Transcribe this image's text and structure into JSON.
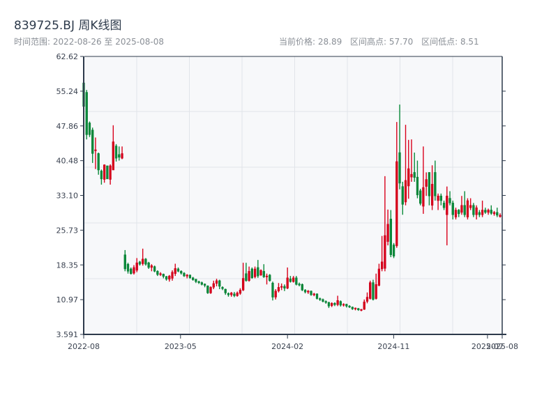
{
  "header": {
    "title": "839725.BJ 周K线图",
    "range": "时间范围: 2022-08-26 至 2025-08-08",
    "current_price": "当前价格: 28.89",
    "range_high": "区间高点: 57.70",
    "range_low": "区间低点: 8.51"
  },
  "chart_data": {
    "type": "candlestick",
    "title": "839725.BJ 周K线图",
    "x_start": "2022-08-26",
    "x_end": "2025-08-08",
    "ylim": [
      3.591,
      62.62
    ],
    "y_ticks": [
      "62.62",
      "55.24",
      "47.86",
      "40.48",
      "33.10",
      "25.73",
      "18.35",
      "10.97",
      "3.591"
    ],
    "x_ticks": [
      {
        "label": "2022-08",
        "date": "2022-08-26"
      },
      {
        "label": "2023-05",
        "date": "2023-05-01"
      },
      {
        "label": "2024-02",
        "date": "2024-02-01"
      },
      {
        "label": "2024-11",
        "date": "2024-11-01"
      },
      {
        "label": "2025-07",
        "date": "2025-07-01"
      },
      {
        "label": "2025-08",
        "date": "2025-08-08"
      }
    ],
    "grid": true,
    "colors": {
      "up": "#d9001b",
      "down": "#0a8a3a",
      "background": "#f7f8fa",
      "grid": "#e1e4e9",
      "axis": "#2d3a4b"
    },
    "candle_fields": [
      "open",
      "close",
      "low",
      "high"
    ],
    "candles": [
      [
        57.0,
        52.0,
        51.5,
        57.7
      ],
      [
        55.0,
        46.0,
        45.0,
        55.5
      ],
      [
        48.5,
        46.0,
        45.5,
        48.8
      ],
      [
        47.0,
        42.0,
        40.0,
        47.5
      ],
      [
        42.6,
        42.8,
        38.7,
        45.4
      ],
      [
        42.0,
        38.5,
        37.5,
        42.2
      ],
      [
        38.3,
        36.6,
        35.4,
        38.6
      ],
      [
        36.5,
        39.6,
        35.8,
        39.7
      ],
      [
        39.4,
        36.6,
        36.6,
        39.4
      ],
      [
        36.5,
        39.4,
        35.4,
        39.7
      ],
      [
        38.5,
        44.5,
        38.5,
        48.0
      ],
      [
        43.6,
        41.0,
        40.3,
        44.0
      ],
      [
        41.8,
        41.2,
        40.5,
        43.5
      ],
      [
        41.0,
        42.0,
        40.8,
        43.5
      ],
      [
        20.5,
        17.5,
        17.0,
        21.5
      ],
      [
        18.5,
        17.0,
        16.5,
        18.8
      ],
      [
        17.5,
        16.5,
        16.3,
        17.8
      ],
      [
        16.6,
        17.8,
        16.3,
        18.3
      ],
      [
        17.2,
        18.8,
        16.8,
        19.8
      ],
      [
        19.0,
        18.5,
        18.2,
        19.2
      ],
      [
        18.6,
        19.6,
        18.2,
        21.8
      ],
      [
        19.6,
        18.5,
        18.2,
        19.8
      ],
      [
        18.8,
        17.8,
        17.5,
        19.0
      ],
      [
        17.8,
        18.2,
        17.0,
        18.5
      ],
      [
        18.0,
        17.0,
        16.8,
        18.2
      ],
      [
        17.0,
        16.3,
        16.0,
        17.2
      ],
      [
        16.3,
        16.5,
        16.0,
        16.8
      ],
      [
        16.4,
        15.9,
        15.5,
        16.5
      ],
      [
        15.9,
        15.3,
        15.0,
        16.0
      ],
      [
        15.3,
        16.0,
        14.8,
        16.2
      ],
      [
        15.5,
        16.8,
        15.0,
        17.2
      ],
      [
        16.5,
        17.6,
        16.0,
        18.6
      ],
      [
        17.5,
        17.0,
        16.8,
        17.8
      ],
      [
        17.0,
        16.6,
        16.3,
        17.2
      ],
      [
        16.6,
        16.0,
        15.8,
        16.8
      ],
      [
        16.0,
        16.2,
        15.5,
        16.4
      ],
      [
        16.2,
        15.6,
        15.4,
        16.3
      ],
      [
        15.6,
        15.2,
        15.0,
        15.8
      ],
      [
        15.3,
        14.8,
        14.5,
        15.4
      ],
      [
        14.8,
        14.6,
        14.3,
        15.0
      ],
      [
        14.6,
        14.2,
        14.0,
        14.8
      ],
      [
        14.3,
        14.0,
        13.6,
        14.4
      ],
      [
        13.9,
        12.4,
        12.2,
        14.0
      ],
      [
        12.4,
        13.6,
        12.2,
        13.8
      ],
      [
        13.6,
        14.4,
        13.2,
        15.0
      ],
      [
        14.4,
        15.0,
        13.8,
        15.4
      ],
      [
        15.0,
        13.8,
        13.2,
        15.2
      ],
      [
        13.6,
        13.3,
        13.0,
        13.8
      ],
      [
        13.2,
        12.4,
        12.0,
        13.3
      ],
      [
        12.3,
        12.0,
        11.6,
        12.5
      ],
      [
        12.0,
        12.4,
        11.6,
        12.6
      ],
      [
        12.2,
        11.8,
        11.5,
        12.6
      ],
      [
        11.8,
        12.4,
        11.6,
        12.7
      ],
      [
        12.3,
        13.0,
        12.0,
        13.4
      ],
      [
        13.0,
        15.5,
        12.8,
        18.8
      ],
      [
        16.5,
        15.0,
        14.8,
        18.8
      ],
      [
        15.0,
        17.0,
        14.8,
        18.0
      ],
      [
        17.5,
        15.6,
        15.4,
        17.8
      ],
      [
        15.8,
        17.5,
        15.5,
        18.0
      ],
      [
        17.8,
        16.0,
        15.6,
        19.4
      ],
      [
        16.2,
        17.2,
        16.0,
        17.4
      ],
      [
        17.0,
        15.8,
        15.6,
        18.5
      ],
      [
        15.8,
        16.0,
        14.2,
        16.5
      ],
      [
        16.2,
        15.0,
        14.8,
        16.4
      ],
      [
        14.5,
        11.5,
        10.8,
        14.8
      ],
      [
        11.5,
        12.8,
        11.0,
        13.2
      ],
      [
        12.8,
        13.6,
        12.5,
        14.5
      ],
      [
        13.6,
        13.8,
        13.0,
        14.4
      ],
      [
        13.8,
        13.4,
        12.8,
        14.2
      ],
      [
        13.4,
        15.6,
        13.2,
        17.8
      ],
      [
        15.4,
        14.8,
        14.6,
        16.0
      ],
      [
        14.8,
        15.6,
        14.6,
        16.0
      ],
      [
        15.6,
        14.2,
        14.0,
        16.0
      ],
      [
        14.3,
        14.2,
        13.8,
        14.6
      ],
      [
        14.2,
        13.0,
        12.8,
        14.4
      ],
      [
        13.0,
        12.6,
        12.3,
        13.2
      ],
      [
        12.6,
        12.8,
        12.2,
        13.0
      ],
      [
        12.8,
        12.0,
        11.8,
        12.9
      ],
      [
        12.0,
        12.2,
        11.7,
        12.4
      ],
      [
        12.2,
        11.2,
        11.0,
        12.3
      ],
      [
        11.2,
        11.0,
        10.7,
        11.4
      ],
      [
        11.0,
        10.6,
        10.4,
        11.2
      ],
      [
        10.6,
        10.4,
        10.1,
        10.8
      ],
      [
        10.4,
        9.6,
        9.2,
        10.5
      ],
      [
        9.7,
        10.2,
        9.4,
        10.4
      ],
      [
        10.2,
        9.9,
        9.6,
        10.4
      ],
      [
        9.9,
        10.8,
        9.6,
        11.8
      ],
      [
        10.6,
        9.8,
        9.5,
        10.8
      ],
      [
        9.8,
        10.0,
        9.5,
        10.2
      ],
      [
        10.0,
        9.6,
        9.3,
        10.1
      ],
      [
        9.6,
        9.4,
        9.2,
        9.8
      ],
      [
        9.4,
        9.0,
        8.8,
        9.5
      ],
      [
        9.0,
        9.2,
        8.7,
        9.3
      ],
      [
        9.1,
        8.8,
        8.6,
        9.2
      ],
      [
        8.8,
        8.9,
        8.51,
        9.0
      ],
      [
        8.9,
        10.5,
        8.8,
        11.0
      ],
      [
        10.6,
        11.5,
        10.2,
        12.5
      ],
      [
        11.2,
        14.6,
        11.0,
        15.0
      ],
      [
        14.6,
        11.0,
        10.8,
        15.2
      ],
      [
        11.2,
        14.2,
        11.0,
        16.5
      ],
      [
        14.0,
        17.5,
        13.8,
        18.6
      ],
      [
        17.5,
        19.0,
        17.0,
        24.5
      ],
      [
        17.6,
        24.6,
        17.0,
        37.2
      ],
      [
        23.3,
        27.0,
        22.5,
        30.1
      ],
      [
        28.1,
        20.5,
        20.0,
        30.0
      ],
      [
        22.6,
        20.2,
        19.8,
        23.0
      ],
      [
        22.4,
        40.3,
        22.0,
        48.7
      ],
      [
        42.2,
        35.7,
        34.4,
        52.4
      ],
      [
        35.0,
        31.2,
        29.0,
        36.0
      ],
      [
        31.7,
        36.3,
        31.0,
        48.1
      ],
      [
        35.1,
        38.8,
        32.4,
        44.9
      ],
      [
        37.0,
        37.6,
        36.0,
        45.0
      ],
      [
        38.0,
        36.9,
        36.0,
        42.2
      ],
      [
        37.0,
        33.2,
        32.5,
        40.5
      ],
      [
        34.1,
        31.4,
        31.0,
        34.5
      ],
      [
        30.8,
        34.8,
        29.2,
        43.5
      ],
      [
        35.0,
        36.5,
        33.0,
        38.0
      ],
      [
        38.0,
        33.0,
        31.0,
        38.0
      ],
      [
        31.0,
        35.5,
        30.0,
        39.5
      ],
      [
        38.0,
        33.0,
        32.0,
        40.5
      ],
      [
        32.0,
        33.0,
        30.0,
        33.5
      ],
      [
        33.0,
        32.0,
        31.0,
        33.5
      ],
      [
        31.5,
        30.5,
        30.0,
        32.0
      ],
      [
        29.0,
        33.0,
        22.5,
        35.0
      ],
      [
        32.5,
        31.5,
        31.0,
        34.0
      ],
      [
        31.5,
        29.0,
        28.0,
        32.0
      ],
      [
        28.5,
        30.0,
        28.0,
        30.5
      ],
      [
        30.0,
        29.2,
        28.5,
        30.2
      ],
      [
        29.5,
        31.0,
        29.0,
        33.0
      ],
      [
        31.0,
        29.0,
        28.5,
        34.0
      ],
      [
        28.5,
        32.0,
        28.0,
        32.5
      ],
      [
        30.5,
        31.0,
        30.0,
        32.5
      ],
      [
        31.0,
        29.0,
        28.5,
        31.5
      ],
      [
        29.0,
        30.5,
        28.0,
        31.0
      ],
      [
        29.5,
        29.0,
        28.5,
        30.0
      ],
      [
        29.0,
        30.0,
        28.5,
        32.0
      ],
      [
        30.0,
        29.5,
        29.2,
        30.5
      ],
      [
        29.5,
        30.0,
        29.0,
        30.3
      ],
      [
        30.0,
        29.3,
        29.0,
        31.0
      ],
      [
        29.2,
        29.5,
        28.8,
        29.8
      ],
      [
        29.5,
        28.9,
        28.5,
        30.5
      ],
      [
        28.6,
        28.9,
        28.4,
        29.3
      ]
    ]
  }
}
